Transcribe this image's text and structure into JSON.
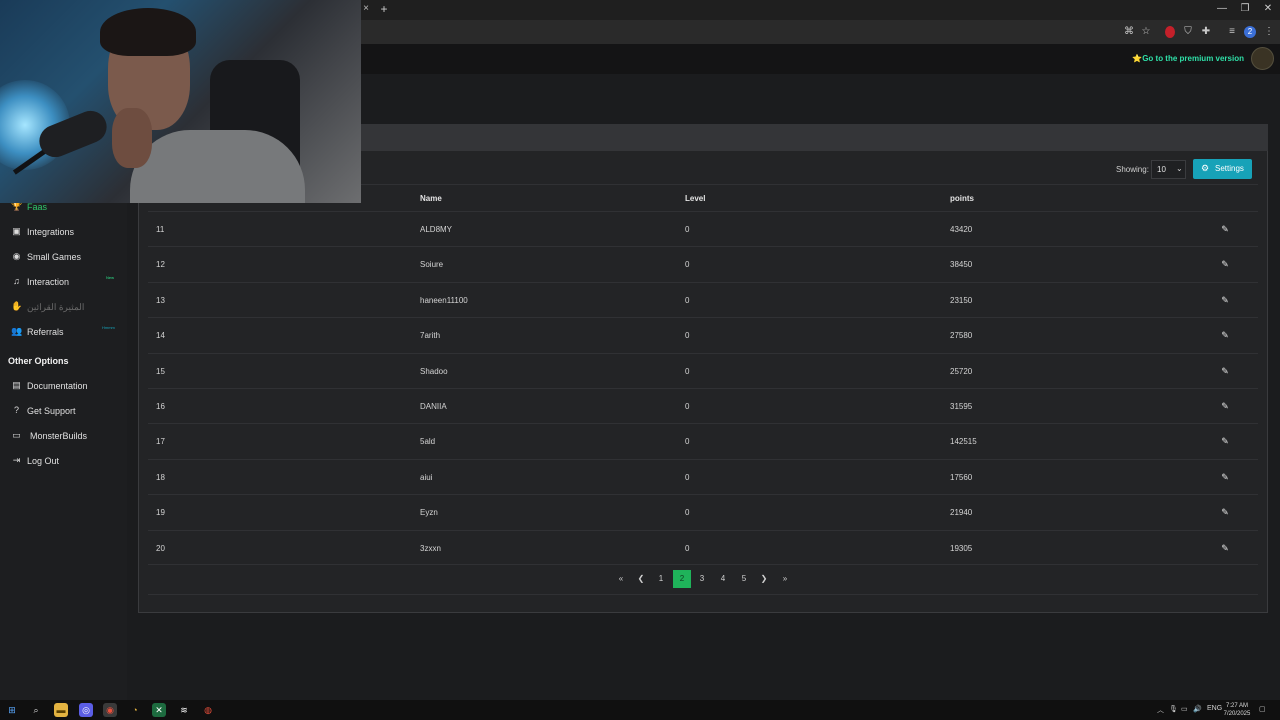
{
  "browser": {
    "new_tab_symbol": "+",
    "tab_close_symbol": "×",
    "window_controls": [
      "—",
      "❐",
      "✕"
    ],
    "profile_badge": "2"
  },
  "header": {
    "premium_link": "⭐Go to the premium version"
  },
  "sidebar": {
    "items": [
      {
        "label": "Faas",
        "icon": "trophy-icon",
        "glyph": "🏆"
      },
      {
        "label": "Integrations",
        "icon": "box-icon",
        "glyph": "▣"
      },
      {
        "label": "Small Games",
        "icon": "gamepad-icon",
        "glyph": "◉"
      },
      {
        "label": "Interaction",
        "icon": "music-icon",
        "glyph": "♫",
        "badge": "New"
      },
      {
        "label": "المثيرة القرائين",
        "icon": "handshake-icon",
        "glyph": "✋"
      },
      {
        "label": "Referrals",
        "icon": "users-icon",
        "glyph": "👥",
        "badge": "Hmmm"
      }
    ],
    "section_title": "Other Options",
    "other_items": [
      {
        "label": "Documentation",
        "icon": "book-icon",
        "glyph": "▤"
      },
      {
        "label": "Get Support",
        "icon": "question-icon",
        "glyph": "?"
      },
      {
        "label": "MonsterBuilds",
        "icon": "laptop-icon",
        "glyph": "▭"
      },
      {
        "label": "Log Out",
        "icon": "logout-icon",
        "glyph": "⇥"
      }
    ]
  },
  "toolbar": {
    "showing_label": "Showing:",
    "showing_value": "10",
    "settings_label": "Settings"
  },
  "table": {
    "columns": [
      "Name",
      "Level",
      "points"
    ],
    "rows": [
      {
        "rank": "11",
        "name": "ALD8MY",
        "level": "0",
        "points": "43420"
      },
      {
        "rank": "12",
        "name": "Soiure",
        "level": "0",
        "points": "38450"
      },
      {
        "rank": "13",
        "name": "haneen11100",
        "level": "0",
        "points": "23150"
      },
      {
        "rank": "14",
        "name": "7arith",
        "level": "0",
        "points": "27580"
      },
      {
        "rank": "15",
        "name": "Shadoo",
        "level": "0",
        "points": "25720"
      },
      {
        "rank": "16",
        "name": "DANIIA",
        "level": "0",
        "points": "31595"
      },
      {
        "rank": "17",
        "name": "5ald",
        "level": "0",
        "points": "142515"
      },
      {
        "rank": "18",
        "name": "aiui",
        "level": "0",
        "points": "17560"
      },
      {
        "rank": "19",
        "name": "Eyzn",
        "level": "0",
        "points": "21940"
      },
      {
        "rank": "20",
        "name": "3zxxn",
        "level": "0",
        "points": "19305"
      }
    ]
  },
  "pagination": {
    "first": "«",
    "prev": "❮",
    "pages": [
      "1",
      "2",
      "3",
      "4",
      "5"
    ],
    "current": "2",
    "next": "❯",
    "last": "»"
  },
  "taskbar": {
    "lang": "ENG",
    "time": "7:27 AM",
    "date": "7/20/2025"
  },
  "colors": {
    "accent_settings": "#17a2b8",
    "active_page": "#1fb35a",
    "premium": "#2fe0a8"
  }
}
